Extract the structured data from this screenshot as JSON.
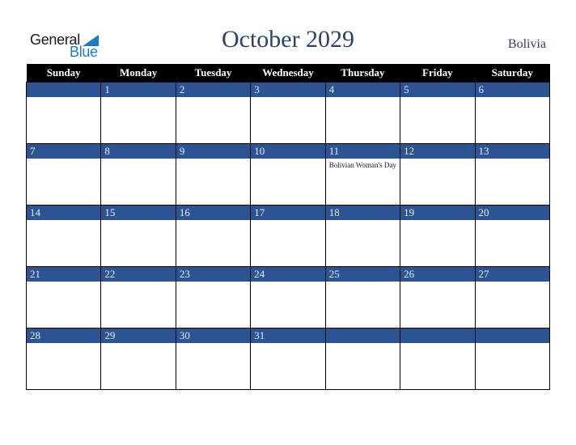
{
  "logo": {
    "line1": "General",
    "line2": "Blue"
  },
  "header": {
    "title": "October 2029",
    "country": "Bolivia"
  },
  "weekdays": [
    "Sunday",
    "Monday",
    "Tuesday",
    "Wednesday",
    "Thursday",
    "Friday",
    "Saturday"
  ],
  "weeks": [
    [
      {
        "day": ""
      },
      {
        "day": "1"
      },
      {
        "day": "2"
      },
      {
        "day": "3"
      },
      {
        "day": "4"
      },
      {
        "day": "5"
      },
      {
        "day": "6"
      }
    ],
    [
      {
        "day": "7"
      },
      {
        "day": "8"
      },
      {
        "day": "9"
      },
      {
        "day": "10"
      },
      {
        "day": "11",
        "event": "Bolivian Woman's Day"
      },
      {
        "day": "12"
      },
      {
        "day": "13"
      }
    ],
    [
      {
        "day": "14"
      },
      {
        "day": "15"
      },
      {
        "day": "16"
      },
      {
        "day": "17"
      },
      {
        "day": "18"
      },
      {
        "day": "19"
      },
      {
        "day": "20"
      }
    ],
    [
      {
        "day": "21"
      },
      {
        "day": "22"
      },
      {
        "day": "23"
      },
      {
        "day": "24"
      },
      {
        "day": "25"
      },
      {
        "day": "26"
      },
      {
        "day": "27"
      }
    ],
    [
      {
        "day": "28"
      },
      {
        "day": "29"
      },
      {
        "day": "30"
      },
      {
        "day": "31"
      },
      {
        "day": ""
      },
      {
        "day": ""
      },
      {
        "day": ""
      }
    ]
  ],
  "colors": {
    "day_bar": "#2c5494",
    "title": "#2a4170",
    "logo_blue": "#1e7bc3"
  }
}
